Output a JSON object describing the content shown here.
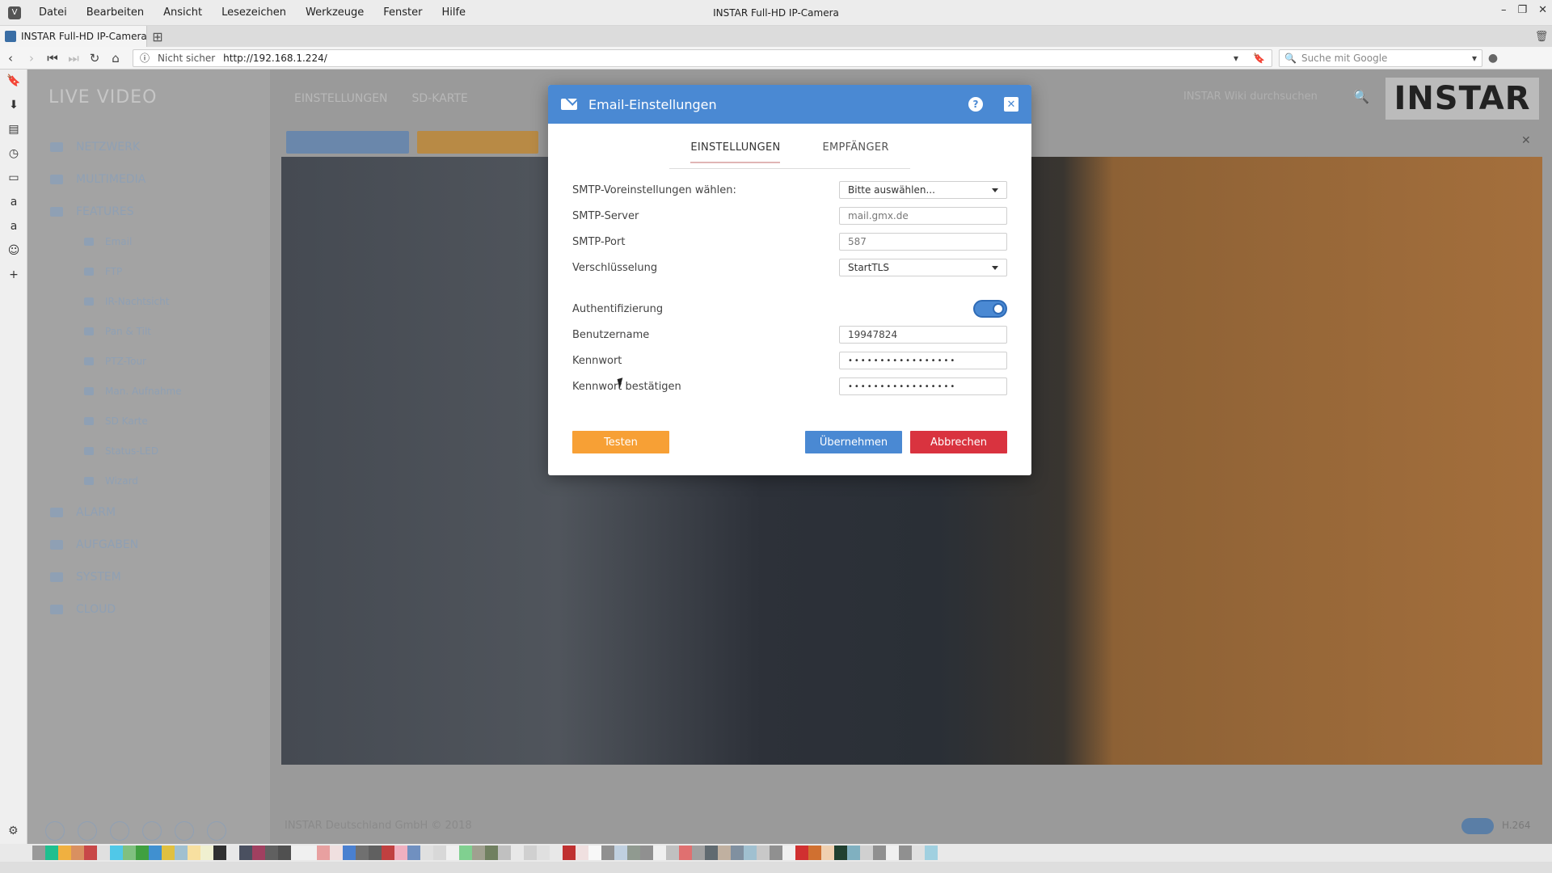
{
  "browser": {
    "menu": [
      "Datei",
      "Bearbeiten",
      "Ansicht",
      "Lesezeichen",
      "Werkzeuge",
      "Fenster",
      "Hilfe"
    ],
    "window_title": "INSTAR Full-HD IP-Camera",
    "tab_title": "INSTAR Full-HD IP-Camera",
    "security_label": "Nicht sicher",
    "url": "http://192.168.1.224/",
    "search_placeholder": "Suche mit Google",
    "window_controls": [
      "–",
      "❐",
      "✕"
    ]
  },
  "page_bg": {
    "logo": "LIVE VIDEO",
    "nav": [
      "NETZWERK",
      "MULTIMEDIA",
      "FEATURES",
      "ALARM",
      "AUFGABEN",
      "SYSTEM",
      "CLOUD"
    ],
    "subnav": [
      "Email",
      "FTP",
      "IR-Nachtsicht",
      "Pan & Tilt",
      "PTZ-Tour",
      "Man. Aufnahme",
      "SD Karte",
      "Status-LED",
      "Wizard"
    ],
    "topnav": [
      "EINSTELLUNGEN",
      "SD-KARTE"
    ],
    "wiki_search": "INSTAR Wiki durchsuchen",
    "brand": "INSTAR",
    "footer": "INSTAR Deutschland GmbH © 2018",
    "codec": "H.264"
  },
  "modal": {
    "title": "Email-Einstellungen",
    "help_label": "?",
    "close_label": "✕",
    "tabs": [
      "EINSTELLUNGEN",
      "EMPFÄNGER"
    ],
    "active_tab": "EINSTELLUNGEN",
    "fields": {
      "smtp_preset": {
        "label": "SMTP-Voreinstellungen wählen:",
        "value": "Bitte auswählen..."
      },
      "smtp_server": {
        "label": "SMTP-Server",
        "value": "mail.gmx.de"
      },
      "smtp_port": {
        "label": "SMTP-Port",
        "value": "587"
      },
      "encryption": {
        "label": "Verschlüsselung",
        "value": "StartTLS"
      },
      "auth": {
        "label": "Authentifizierung",
        "enabled": true
      },
      "username": {
        "label": "Benutzername",
        "value": "19947824"
      },
      "password": {
        "label": "Kennwort",
        "value": "•••••••••••••••••"
      },
      "password_confirm": {
        "label": "Kennwort bestätigen",
        "value": "•••••••••••••••••"
      }
    },
    "buttons": {
      "test": "Testen",
      "apply": "Übernehmen",
      "cancel": "Abbrechen"
    },
    "colors": {
      "header": "#4a89d3",
      "test": "#f7a035",
      "apply": "#4a89d3",
      "cancel": "#d9333f"
    }
  }
}
